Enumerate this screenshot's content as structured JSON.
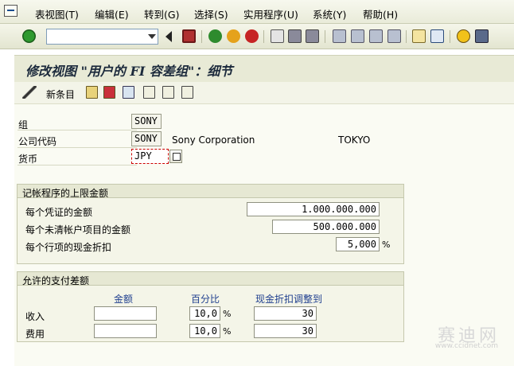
{
  "menu": [
    "表视图(T)",
    "编辑(E)",
    "转到(G)",
    "选择(S)",
    "实用程序(U)",
    "系统(Y)",
    "帮助(H)"
  ],
  "toolbar": {
    "command_value": "",
    "icons": [
      "enter-icon",
      "back-icon",
      "save-icon",
      "green-back-icon",
      "exit-icon",
      "cancel-icon",
      "print-icon",
      "find-icon",
      "find-next-icon",
      "first-page-icon",
      "previous-page-icon",
      "next-page-icon",
      "last-page-icon",
      "create-session-icon",
      "shortcut-icon",
      "help-icon",
      "layout-icon"
    ]
  },
  "title": "修改视图 \"用户的 FI 容差组\"：细节",
  "app_toolbar": {
    "new_entries": "新条目"
  },
  "header_fields": {
    "group_label": "组",
    "group_value": "SONY",
    "company_code_label": "公司代码",
    "company_code_value": "SONY",
    "company_name": "Sony Corporation",
    "city": "TOKYO",
    "currency_label": "货币",
    "currency_value": "JPY"
  },
  "posting_limits": {
    "title": "记帐程序的上限金额",
    "rows": [
      {
        "label": "每个凭证的金额",
        "value": "1.000.000.000"
      },
      {
        "label": "每个未清帐户项目的金额",
        "value": "500.000.000"
      },
      {
        "label": "每个行项的现金折扣",
        "value": "5,000",
        "unit": "%"
      }
    ]
  },
  "payment_differences": {
    "title": "允许的支付差额",
    "col_amount": "金额",
    "col_percent": "百分比",
    "col_cash_discount": "现金折扣调整到",
    "rows": [
      {
        "label": "收入",
        "amount": "",
        "percent": "10,0",
        "unit": "%",
        "cash_discount": "30"
      },
      {
        "label": "费用",
        "amount": "",
        "percent": "10,0",
        "unit": "%",
        "cash_discount": "30"
      }
    ]
  },
  "watermark": {
    "text": "赛迪网",
    "url": "www.ccidnet.com"
  }
}
